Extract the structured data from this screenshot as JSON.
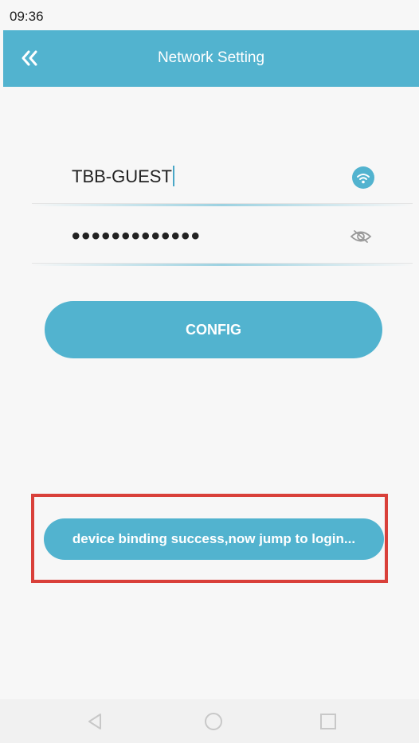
{
  "status_bar": {
    "time": "09:36"
  },
  "header": {
    "title": "Network Setting",
    "back_icon": "double-chevron-left-icon"
  },
  "form": {
    "ssid_value": "TBB-GUEST",
    "ssid_icon": "wifi-icon",
    "password_masked": "•••••••••••••",
    "password_toggle_icon": "eye-off-icon",
    "config_label": "CONFIG"
  },
  "toast": {
    "message": "device binding success,now jump to login..."
  },
  "nav": {
    "back_icon": "triangle-back-icon",
    "home_icon": "circle-home-icon",
    "recents_icon": "square-recents-icon"
  },
  "colors": {
    "accent": "#52b3cf",
    "highlight": "#d9403a",
    "background": "#f7f7f7"
  }
}
